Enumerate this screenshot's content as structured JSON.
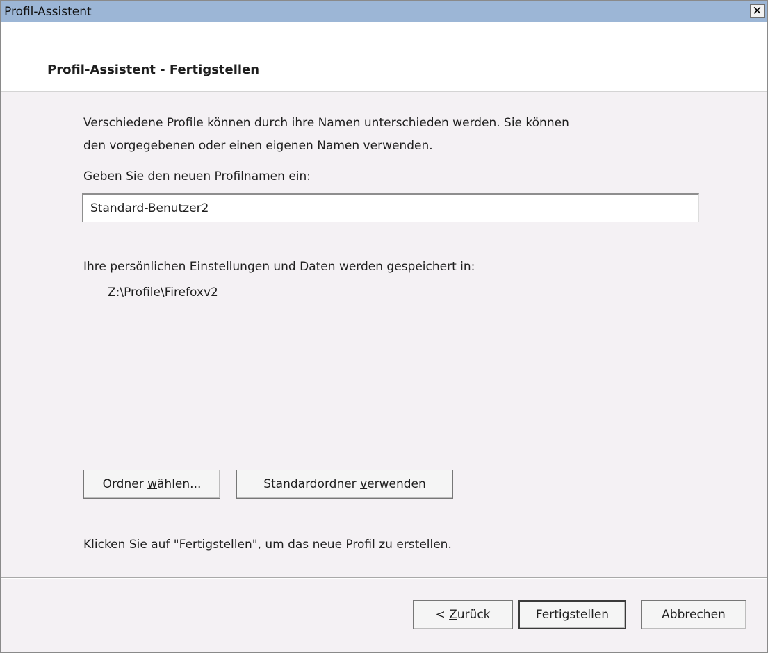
{
  "window": {
    "title": "Profil-Assistent",
    "close_symbol": "✕"
  },
  "header": {
    "title": "Profil-Assistent - Fertigstellen"
  },
  "content": {
    "intro_line1": "Verschiedene Profile können durch ihre Namen unterschieden werden. Sie können",
    "intro_line2": "den vorgegebenen oder einen eigenen Namen verwenden.",
    "name_label_accel": "G",
    "name_label_rest": "eben Sie den neuen Profilnamen ein:",
    "name_value": "Standard-Benutzer2",
    "storage_label": "Ihre persönlichen Einstellungen und Daten werden gespeichert in:",
    "storage_path": "Z:\\Profile\\Firefoxv2",
    "choose_folder": {
      "before": "Ordner ",
      "accel": "w",
      "after": "ählen..."
    },
    "default_folder": {
      "before": "Standardordner ",
      "accel": "v",
      "after": "erwenden"
    },
    "finish_hint": "Klicken Sie auf \"Fertigstellen\", um das neue Profil zu erstellen."
  },
  "footer": {
    "back": {
      "before": "< ",
      "accel": "Z",
      "after": "urück"
    },
    "finish": "Fertigstellen",
    "cancel": "Abbrechen"
  }
}
